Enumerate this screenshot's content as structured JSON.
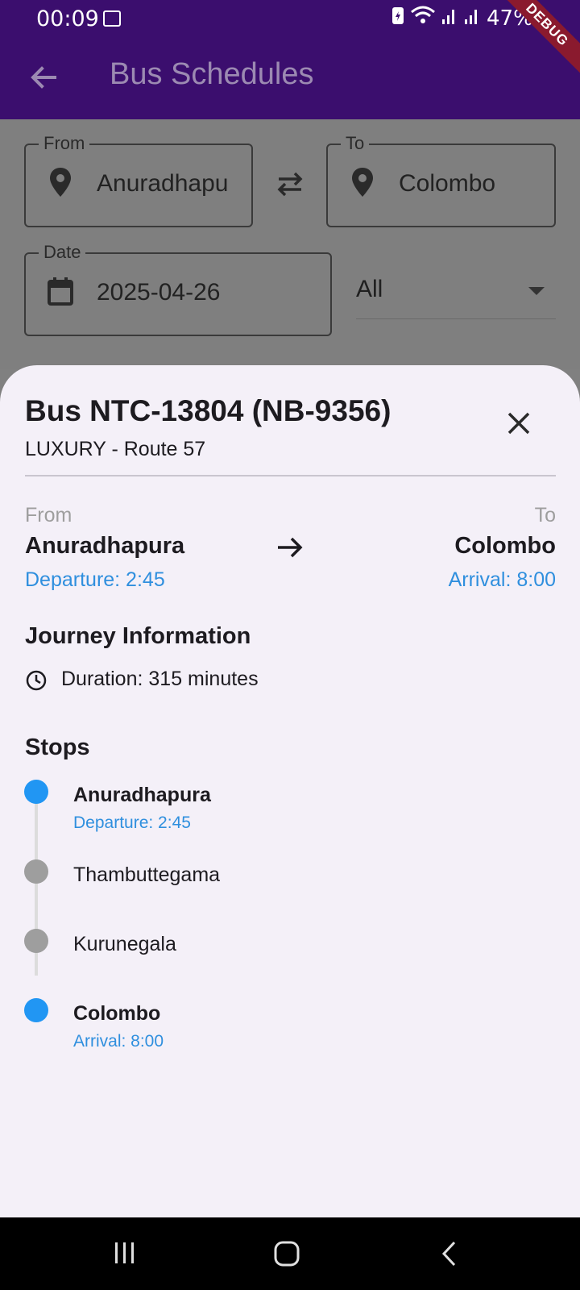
{
  "status_bar": {
    "time": "00:09",
    "battery_percent": "47%"
  },
  "app_bar": {
    "title": "Bus Schedules",
    "debug_banner": "DEBUG"
  },
  "search_form": {
    "from_label": "From",
    "from_value": "Anuradhapu",
    "to_label": "To",
    "to_value": "Colombo",
    "date_label": "Date",
    "date_value": "2025-04-26",
    "filter_value": "All"
  },
  "sheet": {
    "title": "Bus NTC-13804 (NB-9356)",
    "subtitle": "LUXURY - Route 57",
    "from_label": "From",
    "to_label": "To",
    "from_city": "Anuradhapura",
    "to_city": "Colombo",
    "departure": "Departure: 2:45",
    "arrival": "Arrival: 8:00",
    "journey_title": "Journey Information",
    "duration": "Duration: 315 minutes",
    "stops_title": "Stops",
    "stops": [
      {
        "name": "Anuradhapura",
        "time": "Departure: 2:45",
        "terminal": true
      },
      {
        "name": "Thambuttegama",
        "time": "",
        "terminal": false
      },
      {
        "name": "Kurunegala",
        "time": "",
        "terminal": false
      },
      {
        "name": "Colombo",
        "time": "Arrival: 8:00",
        "terminal": true
      }
    ]
  },
  "colors": {
    "app_bar": "#3b0e6e",
    "accent_blue": "#2196f3",
    "sheet_bg": "#f4f0f8"
  }
}
